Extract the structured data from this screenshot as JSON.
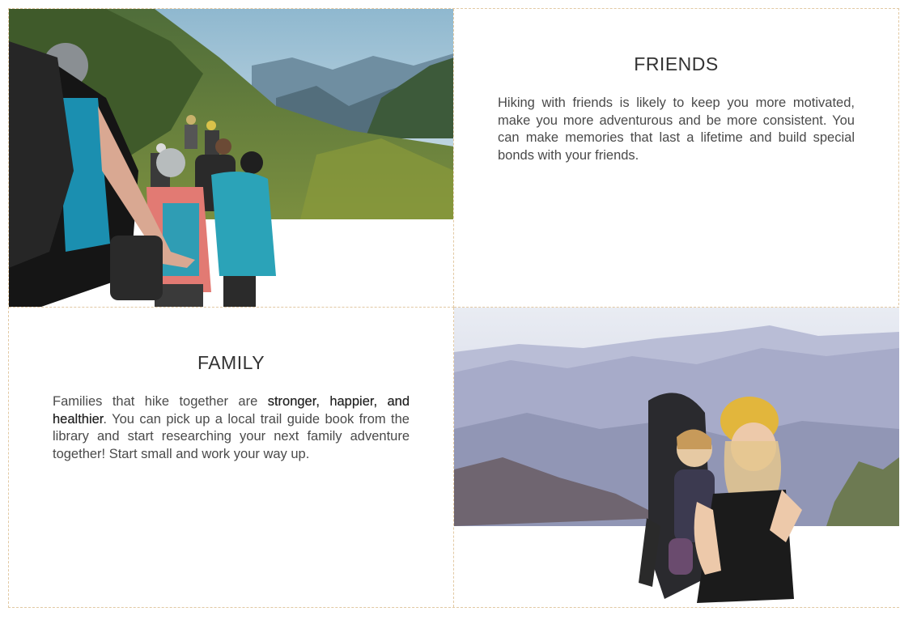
{
  "cards": {
    "friends": {
      "title": "FRIENDS",
      "body": "Hiking with friends is likely to keep you more motivated, make you more adventurous and be more consistent. You can make memories that last a lifetime and build special bonds with your friends.",
      "image_alt": "group hiking on mountain trail"
    },
    "family": {
      "title": "FAMILY",
      "body_before": "Families that hike together are ",
      "body_bold": "stronger, happier, and healthier",
      "body_after": ". You can pick up a local trail guide book from the library and start researching your next family adventure together! Start small and work your way up.",
      "image_alt": "mother hiking with child carrier"
    }
  },
  "colors": {
    "border": "#e2c9a3",
    "text": "#4a4a4a"
  }
}
